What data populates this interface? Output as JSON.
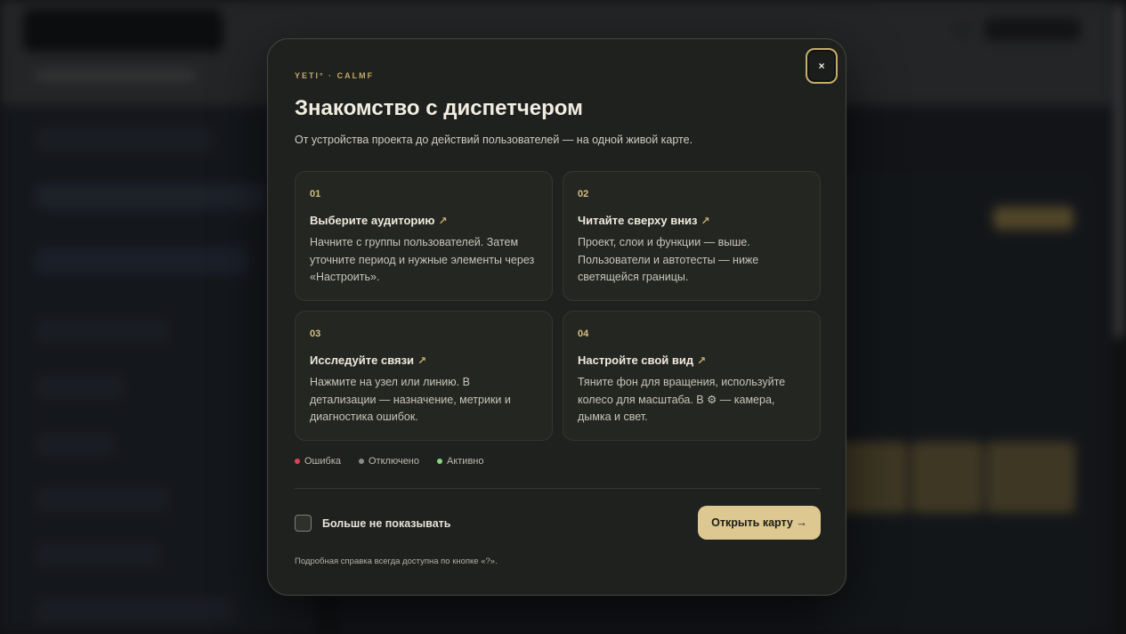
{
  "modal": {
    "eyebrow": "YETI° · CALMF",
    "close_label": "×",
    "title": "Знакомство с диспетчером",
    "subtitle": "От устройства проекта до действий пользователей — на одной живой карте.",
    "steps": [
      {
        "number": "01",
        "title": "Выберите аудиторию",
        "icon": "arrow-up-right-icon",
        "text": "Начните с группы пользователей. Затем уточните период и нужные элементы через «Настроить»."
      },
      {
        "number": "02",
        "title": "Читайте сверху вниз",
        "icon": "arrow-up-right-icon",
        "text": "Проект, слои и функции — выше. Пользователи и автотесты — ниже светящейся границы."
      },
      {
        "number": "03",
        "title": "Исследуйте связи",
        "icon": "arrow-up-right-icon",
        "text": "Нажмите на узел или линию. В детализации — назначение, метрики и диагностика ошибок."
      },
      {
        "number": "04",
        "title": "Настройте свой вид",
        "icon": "arrow-up-right-icon",
        "text": "Тяните фон для вращения, используйте колесо для масштаба. В ⚙ — камера, дымка и свет."
      }
    ],
    "legend": [
      {
        "label": "Ошибка",
        "color": "#e0405e"
      },
      {
        "label": "Отключено",
        "color": "#8b8b86"
      },
      {
        "label": "Активно",
        "color": "#86d47c"
      }
    ],
    "dont_show_label": "Больше не показывать",
    "dont_show_checked": false,
    "primary_button": "Открыть карту →",
    "footnote": "Подробная справка всегда доступна по кнопке «?»."
  },
  "colors": {
    "accent": "#dcc890",
    "modal_bg": "#1f211f",
    "step_number": "#d6bf80"
  }
}
